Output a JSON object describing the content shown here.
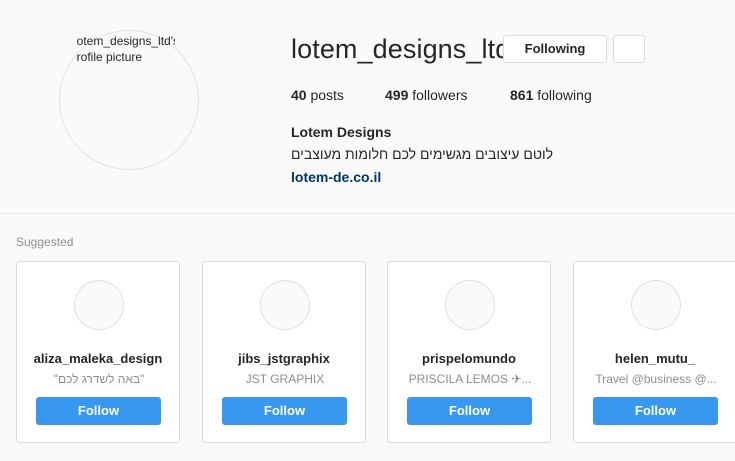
{
  "profile": {
    "avatar_alt_line1": "lotem_designs_ltd's",
    "avatar_alt_line2": "profile picture",
    "username": "lotem_designs_ltd",
    "follow_state_label": "Following",
    "stats": {
      "posts_count": "40",
      "posts_label": "posts",
      "followers_count": "499",
      "followers_label": "followers",
      "following_count": "861",
      "following_label": "following"
    },
    "full_name": "Lotem Designs",
    "bio": "לוטם עיצובים מגשימים לכם חלומות מעוצבים",
    "website": "lotem-de.co.il"
  },
  "suggested": {
    "title": "Suggested",
    "follow_label": "Follow",
    "cards": [
      {
        "username": "aliza_maleka_design",
        "subtitle": "\"באה לשדרג לכם\""
      },
      {
        "username": "jibs_jstgraphix",
        "subtitle": "JST GRAPHIX"
      },
      {
        "username": "prispelomundo",
        "subtitle": "PRISCILA LEMOS ✈..."
      },
      {
        "username": "helen_mutu_",
        "subtitle": "Travel @business @..."
      }
    ]
  }
}
